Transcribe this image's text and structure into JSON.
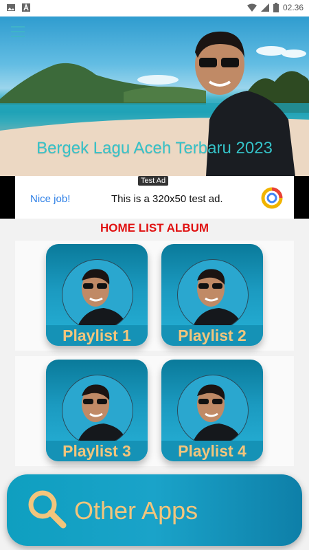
{
  "status_bar": {
    "time": "02.36",
    "left_icons": [
      "gallery-icon",
      "text-a-icon"
    ],
    "right_icons": [
      "wifi-icon",
      "signal-icon",
      "battery-icon"
    ]
  },
  "header": {
    "title": "Bergek Lagu Aceh Terbaru 2023"
  },
  "ad": {
    "tag": "Test Ad",
    "cta": "Nice job!",
    "text": "This is a 320x50 test ad."
  },
  "section": {
    "title": "HOME LIST ALBUM"
  },
  "playlists": [
    {
      "label": "Playlist 1"
    },
    {
      "label": "Playlist 2"
    },
    {
      "label": "Playlist 3"
    },
    {
      "label": "Playlist 4"
    }
  ],
  "other_apps": {
    "label": "Other Apps",
    "icon": "search-icon"
  },
  "colors": {
    "accent": "#1aa3c9",
    "label_gold": "#f2c57c",
    "title_red": "#e01010",
    "header_title": "#35c2c8"
  }
}
